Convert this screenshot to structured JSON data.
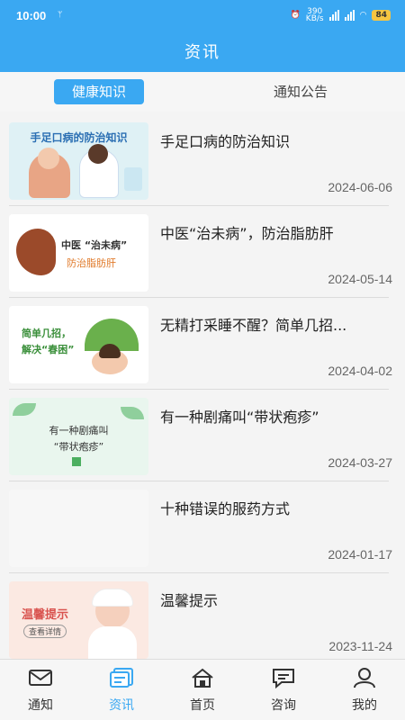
{
  "status": {
    "time": "10:00",
    "net_speed": "390\nKB/s",
    "battery": "84"
  },
  "header": {
    "title": "资讯"
  },
  "tabs": [
    {
      "label": "健康知识",
      "active": true
    },
    {
      "label": "通知公告",
      "active": false
    }
  ],
  "articles": [
    {
      "title": "手足口病的防治知识",
      "date": "2024-06-06",
      "thumb_text": "手足口病的防治知识"
    },
    {
      "title": "中医“治未病”，防治脂肪肝",
      "date": "2024-05-14",
      "thumb_text": "中医 “治未病”",
      "thumb_sub": "防治脂肪肝"
    },
    {
      "title": "无精打采睡不醒？简单几招...",
      "date": "2024-04-02",
      "thumb_text": "简单几招，",
      "thumb_sub": "解决“春困”"
    },
    {
      "title": "有一种剧痛叫“带状疱疹”",
      "date": "2024-03-27",
      "thumb_text": "有一种剧痛叫",
      "thumb_sub": "“带状疱疹”"
    },
    {
      "title": "十种错误的服药方式",
      "date": "2024-01-17"
    },
    {
      "title": "温馨提示",
      "date": "2023-11-24",
      "thumb_text": "温馨提示",
      "thumb_sub": "查看详情"
    }
  ],
  "bottom_nav": [
    {
      "label": "通知",
      "icon": "mail-icon"
    },
    {
      "label": "资讯",
      "icon": "news-icon",
      "active": true
    },
    {
      "label": "首页",
      "icon": "home-icon"
    },
    {
      "label": "咨询",
      "icon": "chat-icon"
    },
    {
      "label": "我的",
      "icon": "user-icon"
    }
  ],
  "colors": {
    "primary": "#3aa8f2",
    "text": "#222222",
    "date": "#666666"
  }
}
